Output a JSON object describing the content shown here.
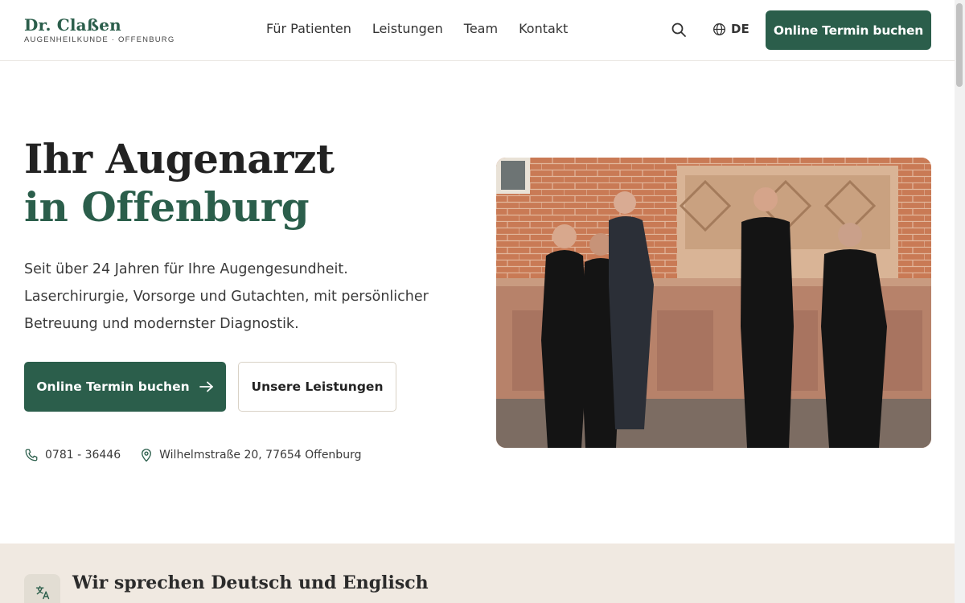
{
  "header": {
    "logo_name": "Dr. Claßen",
    "logo_sub": "AUGENHEILKUNDE · OFFENBURG",
    "nav": [
      {
        "label": "Für Patienten"
      },
      {
        "label": "Leistungen"
      },
      {
        "label": "Team"
      },
      {
        "label": "Kontakt"
      }
    ],
    "search_icon": "search-icon",
    "language": "DE",
    "cta_label": "Online Termin buchen"
  },
  "hero": {
    "title_line1": "Ihr Augenarzt",
    "title_line2": "in Offenburg",
    "text": "Seit über 24 Jahren für Ihre Augengesundheit. Laserchirurgie, Vorsorge und Gutachten, mit persönlicher Betreuung und modernster Diagnostik.",
    "primary_button": "Online Termin buchen",
    "secondary_button": "Unsere Leistungen",
    "phone": "0781 - 36446",
    "address": "Wilhelmstraße 20, 77654 Offenburg"
  },
  "band": {
    "title": "Wir sprechen Deutsch und Englisch",
    "icon": "translate-icon"
  },
  "colors": {
    "brand": "#2b5e4b",
    "band_bg": "#f0e9e1",
    "text": "#2d2d2d"
  }
}
